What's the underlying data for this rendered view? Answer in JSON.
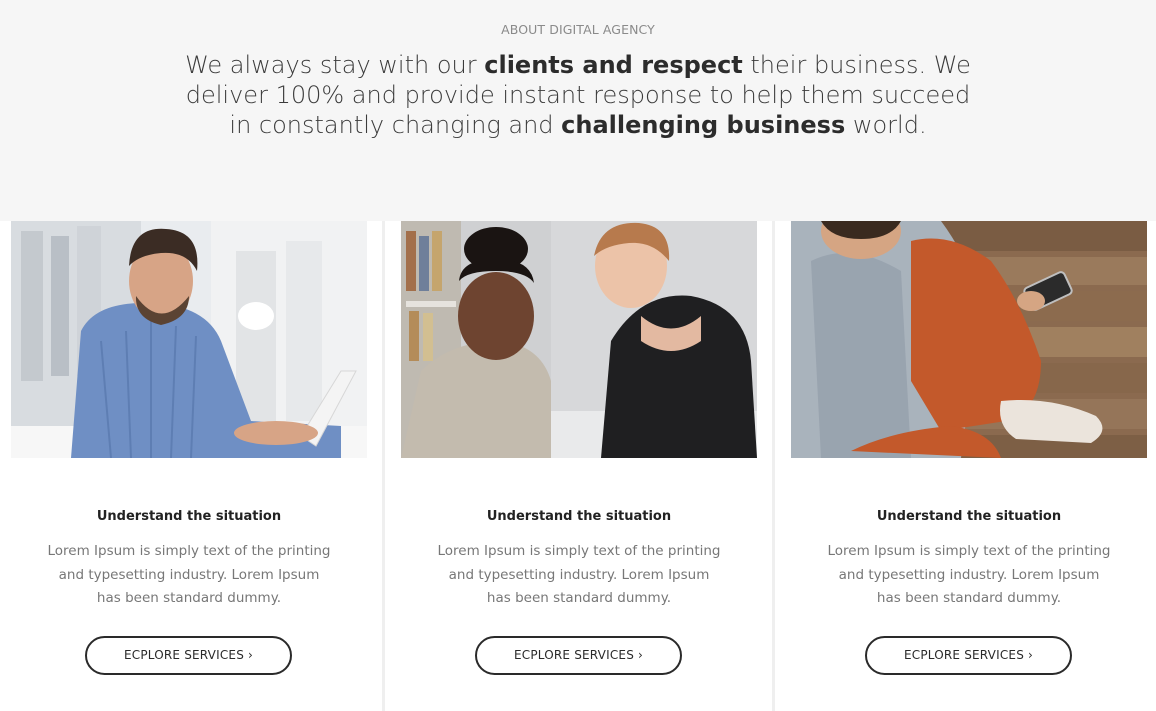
{
  "about": {
    "eyebrow": "ABOUT DIGITAL AGENCY",
    "line1_a": "We always stay with our ",
    "line1_b": "clients and respect",
    "line1_c": " their business. We deliver 100% and provide instant response to help them succeed in constantly changing and ",
    "line1_d": "challenging business",
    "line1_e": " world."
  },
  "cards": [
    {
      "image": "man-typing-laptop-photo",
      "title": "Understand the situation",
      "text": "Lorem Ipsum is simply text of the printing and typesetting industry. Lorem Ipsum has been standard dummy.",
      "button": "ECPLORE SERVICES",
      "chevron": "›"
    },
    {
      "image": "two-women-looking-down-photo",
      "title": "Understand the situation",
      "text": "Lorem Ipsum is simply text of the printing and typesetting industry. Lorem Ipsum has been standard dummy.",
      "button": "ECPLORE SERVICES",
      "chevron": "›"
    },
    {
      "image": "man-sitting-with-phone-photo",
      "title": "Understand the situation",
      "text": "Lorem Ipsum is simply text of the printing and typesetting industry. Lorem Ipsum has been standard dummy.",
      "button": "ECPLORE SERVICES",
      "chevron": "›"
    }
  ],
  "colors": {
    "band": "#f6f6f6",
    "text_dark": "#2c2c2c",
    "text_muted": "#777777",
    "button_border": "#2a2a2a"
  }
}
